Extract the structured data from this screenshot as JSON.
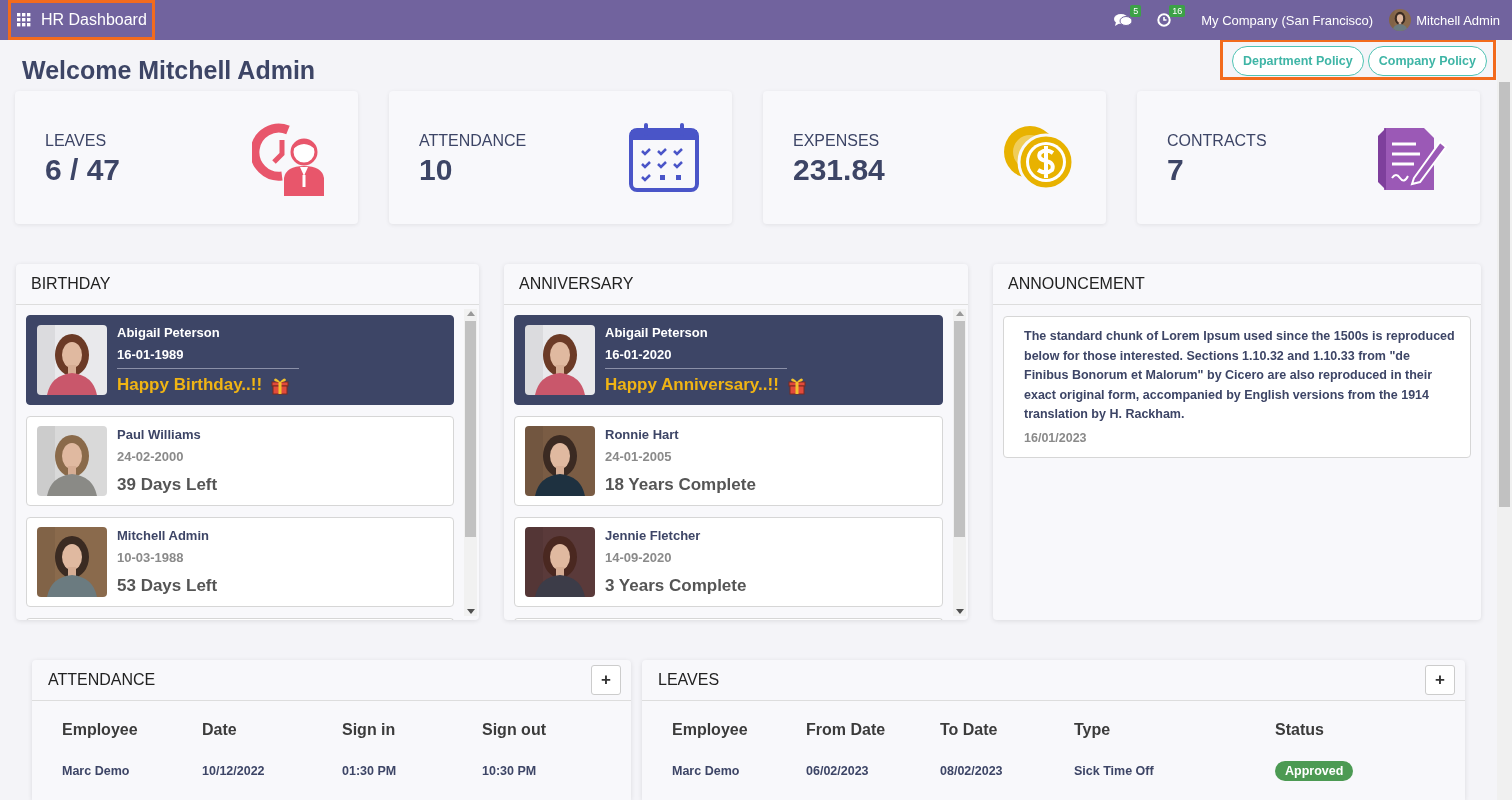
{
  "topbar": {
    "app_title": "HR Dashboard",
    "app_title_highlighted": true,
    "messages_count": "5",
    "activities_count": "16",
    "company": "My Company (San Francisco)",
    "user": "Mitchell Admin"
  },
  "welcome": "Welcome Mitchell Admin",
  "policy_buttons_highlighted": true,
  "policy_buttons": [
    "Department Policy",
    "Company Policy"
  ],
  "stats": [
    {
      "kind": "leaves",
      "label": "LEAVES",
      "value": "6 / 47"
    },
    {
      "kind": "attendance",
      "label": "ATTENDANCE",
      "value": "10"
    },
    {
      "kind": "expenses",
      "label": "EXPENSES",
      "value": "231.84"
    },
    {
      "kind": "contracts",
      "label": "CONTRACTS",
      "value": "7"
    }
  ],
  "birthday": {
    "title": "BIRTHDAY",
    "items": [
      {
        "name": "Abigail Peterson",
        "date": "16-01-1989",
        "today": true,
        "note": "Happy Birthday..!!"
      },
      {
        "name": "Paul Williams",
        "date": "24-02-2000",
        "today": false,
        "note": "39 Days Left"
      },
      {
        "name": "Mitchell Admin",
        "date": "10-03-1988",
        "today": false,
        "note": "53 Days Left"
      }
    ]
  },
  "anniversary": {
    "title": "ANNIVERSARY",
    "items": [
      {
        "name": "Abigail Peterson",
        "date": "16-01-2020",
        "today": true,
        "note": "Happy Anniversary..!!"
      },
      {
        "name": "Ronnie Hart",
        "date": "24-01-2005",
        "today": false,
        "note": "18 Years Complete"
      },
      {
        "name": "Jennie Fletcher",
        "date": "14-09-2020",
        "today": false,
        "note": "3 Years Complete"
      }
    ]
  },
  "announcement": {
    "title": "ANNOUNCEMENT",
    "items": [
      {
        "text": "The standard chunk of Lorem Ipsum used since the 1500s is reproduced below for those interested. Sections 1.10.32 and 1.10.33 from \"de Finibus Bonorum et Malorum\" by Cicero are also reproduced in their exact original form, accompanied by English versions from the 1914 translation by H. Rackham.",
        "date": "16/01/2023"
      }
    ]
  },
  "attendance_table": {
    "title": "ATTENDANCE",
    "add_button": "+",
    "columns": [
      "Employee",
      "Date",
      "Sign in",
      "Sign out"
    ],
    "rows": [
      [
        "Marc Demo",
        "10/12/2022",
        "01:30 PM",
        "10:30 PM"
      ]
    ]
  },
  "leaves_table": {
    "title": "LEAVES",
    "add_button": "+",
    "columns": [
      "Employee",
      "From Date",
      "To Date",
      "Type",
      "Status"
    ],
    "rows": [
      {
        "cells": [
          "Marc Demo",
          "06/02/2023",
          "08/02/2023",
          "Sick Time Off"
        ],
        "status": "Approved"
      }
    ]
  }
}
